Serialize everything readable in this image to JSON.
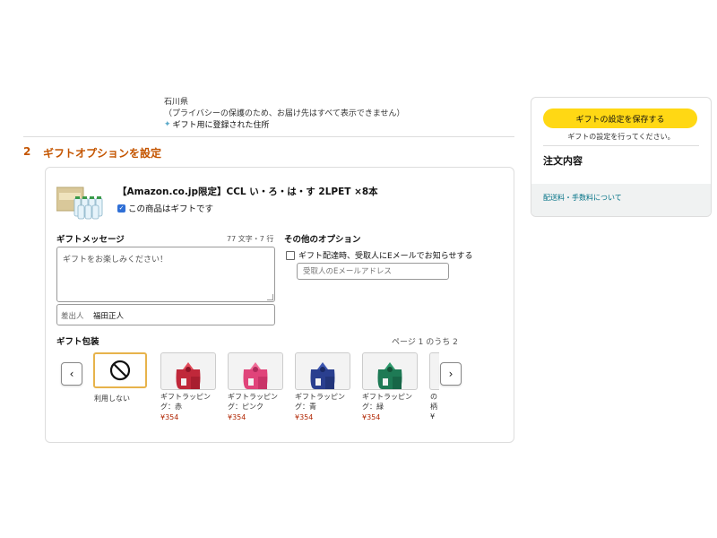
{
  "address": {
    "prefecture": "石川県",
    "privacy_note": "（プライバシーの保護のため、お届け先はすべて表示できません）",
    "gift_address_label": "ギフト用に登録された住所"
  },
  "section": {
    "number": "2",
    "title": "ギフトオプションを設定"
  },
  "product": {
    "title": "【Amazon.co.jp限定】CCL い・ろ・は・す 2LPET ×8本",
    "gift_checkbox_label": "この商品はギフトです"
  },
  "message": {
    "label": "ギフトメッセージ",
    "count": "77 文字・7 行",
    "text": "ギフトをお楽しみください！",
    "sender_label": "差出人",
    "sender_name": "福田正人"
  },
  "other_options": {
    "label": "その他のオプション",
    "notify_label": "ギフト配達時、受取人にEメールでお知らせする",
    "email_placeholder": "受取人のEメールアドレス"
  },
  "wrapping": {
    "label": "ギフト包装",
    "page_indicator": "ページ 1 のうち 2",
    "none_label": "利用しない",
    "items": [
      {
        "name": "ギフトラッピング：赤",
        "price": "¥354",
        "color": "#c0283a"
      },
      {
        "name": "ギフトラッピング：ピンク",
        "price": "¥354",
        "color": "#e0447a"
      },
      {
        "name": "ギフトラッピング：青",
        "price": "¥354",
        "color": "#2a3f8f"
      },
      {
        "name": "ギフトラッピング：緑",
        "price": "¥354",
        "color": "#1e7a55"
      },
      {
        "name": "の\n柄\n¥",
        "price": "",
        "color": "#cccccc"
      }
    ]
  },
  "sidebar": {
    "save_button": "ギフトの設定を保存する",
    "save_note": "ギフトの設定を行ってください。",
    "order_title": "注文内容",
    "fees_link": "配送料・手数料について"
  },
  "colors": {
    "accent": "#c45500",
    "button_yellow": "#ffd814",
    "link": "#007185",
    "price": "#b12704"
  }
}
